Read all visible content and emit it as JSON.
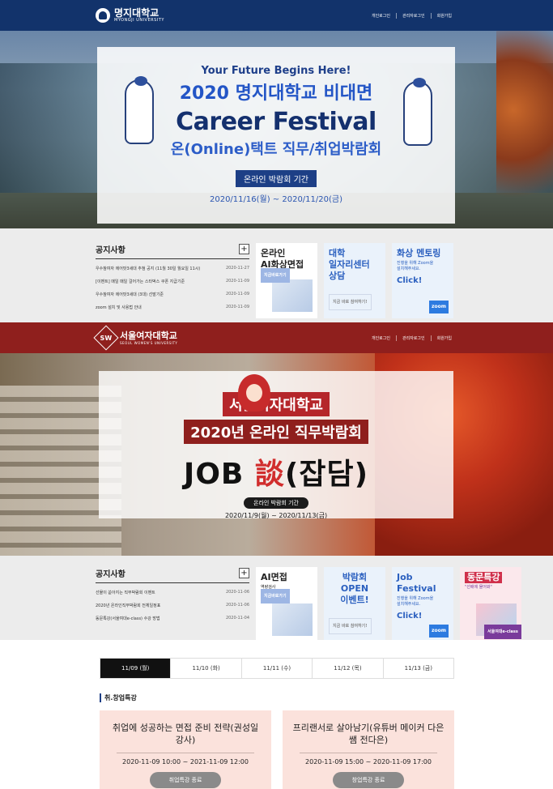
{
  "mju": {
    "header": {
      "logo_name": "명지대학교",
      "logo_en": "MYONGJI UNIVERSITY",
      "links": [
        "개인로그인",
        "관리자로그인",
        "회원가입"
      ]
    },
    "hero": {
      "line1": "Your Future Begins Here!",
      "line2": "2020 명지대학교 비대면",
      "line3": "Career Festival",
      "line4": "온(Online)택트 직무/취업박람회",
      "period_label": "온라인 박람회 기간",
      "period": "2020/11/16(월) ~ 2020/11/20(금)"
    },
    "notice": {
      "title": "공지사항",
      "items": [
        {
          "text": "우수참여자 에어팟3세대 추첨 공지 (11월 30일 월요일 11시)",
          "date": "2020-11-27"
        },
        {
          "text": "[이벤트] 매일 매일 걸어가는 스타벅스 쿠폰 지급기준",
          "date": "2020-11-09"
        },
        {
          "text": "우수참여자 에어팟3세대 (3대) 선발기준",
          "date": "2020-11-09"
        },
        {
          "text": "zoom 설치 및 사용법 안내",
          "date": "2020-11-09"
        }
      ]
    },
    "tiles": [
      {
        "title": "온라인\nAI화상면접",
        "sub": "",
        "btn": "지금바로가기"
      },
      {
        "title": "대학\n일자리센터\n상담",
        "sub": "",
        "btn": "지금 바로 참여하기!"
      },
      {
        "title": "화상 멘토링",
        "sub": "진행을 위해 Zoom을\n설치해주세요.",
        "cta": "Click!",
        "btn": "zoom"
      }
    ]
  },
  "swu": {
    "header": {
      "logo_mark": "SW",
      "logo_name": "서울여자대학교",
      "logo_en": "SEOUL WOMEN'S UNIVERSITY",
      "links": [
        "개인로그인",
        "관리자로그인",
        "회원가입"
      ]
    },
    "hero": {
      "line1": "서울여자대학교",
      "line2": "2020년 온라인 직무박람회",
      "line3a": "JOB ",
      "line3b": "談",
      "line3c": "(잡담)",
      "period_label": "온라인 박람회 기간",
      "period": "2020/11/9(월) ~ 2020/11/13(금)"
    },
    "notice": {
      "title": "공지사항",
      "items": [
        {
          "text": "선물이 쏟아지는 직무박람회 이벤트",
          "date": "2020-11-06"
        },
        {
          "text": "2020년 온라인직무박람회 전체일정표",
          "date": "2020-11-06"
        },
        {
          "text": "동문특강(서울여대e-class) 수강 방법",
          "date": "2020-11-04"
        }
      ]
    },
    "tiles": [
      {
        "title": "AI면접",
        "sub": "역량검사",
        "btn": "지금바로가기"
      },
      {
        "title": "박람회\nOPEN\n이벤트!",
        "btn": "지금 바로 참여하기!"
      },
      {
        "title": "Job Festival",
        "sub": "진행을 위해 Zoom을\n설치해주세요.",
        "cta": "Click!",
        "btn": "zoom"
      },
      {
        "title": "동문특강",
        "sub": "\"선배에 물어봐\"",
        "btn": "서울여대e-class"
      }
    ]
  },
  "schedule": {
    "tabs": [
      "11/09 (월)",
      "11/10 (화)",
      "11/11 (수)",
      "11/12 (목)",
      "11/13 (금)"
    ],
    "section_title": "취.창업특강",
    "lectures": [
      {
        "title": "취업에 성공하는 면접 준비 전략(권성일 강사)",
        "time": "2020-11-09  10:00 ~ 2021-11-09  12:00",
        "button": "취업특강 종료"
      },
      {
        "title": "프리랜서로 살아남기(유튜버 메이커 다은쌤 전다은)",
        "time": "2020-11-09  15:00 ~ 2020-11-09  17:00",
        "button": "창업특강 종료"
      }
    ]
  }
}
